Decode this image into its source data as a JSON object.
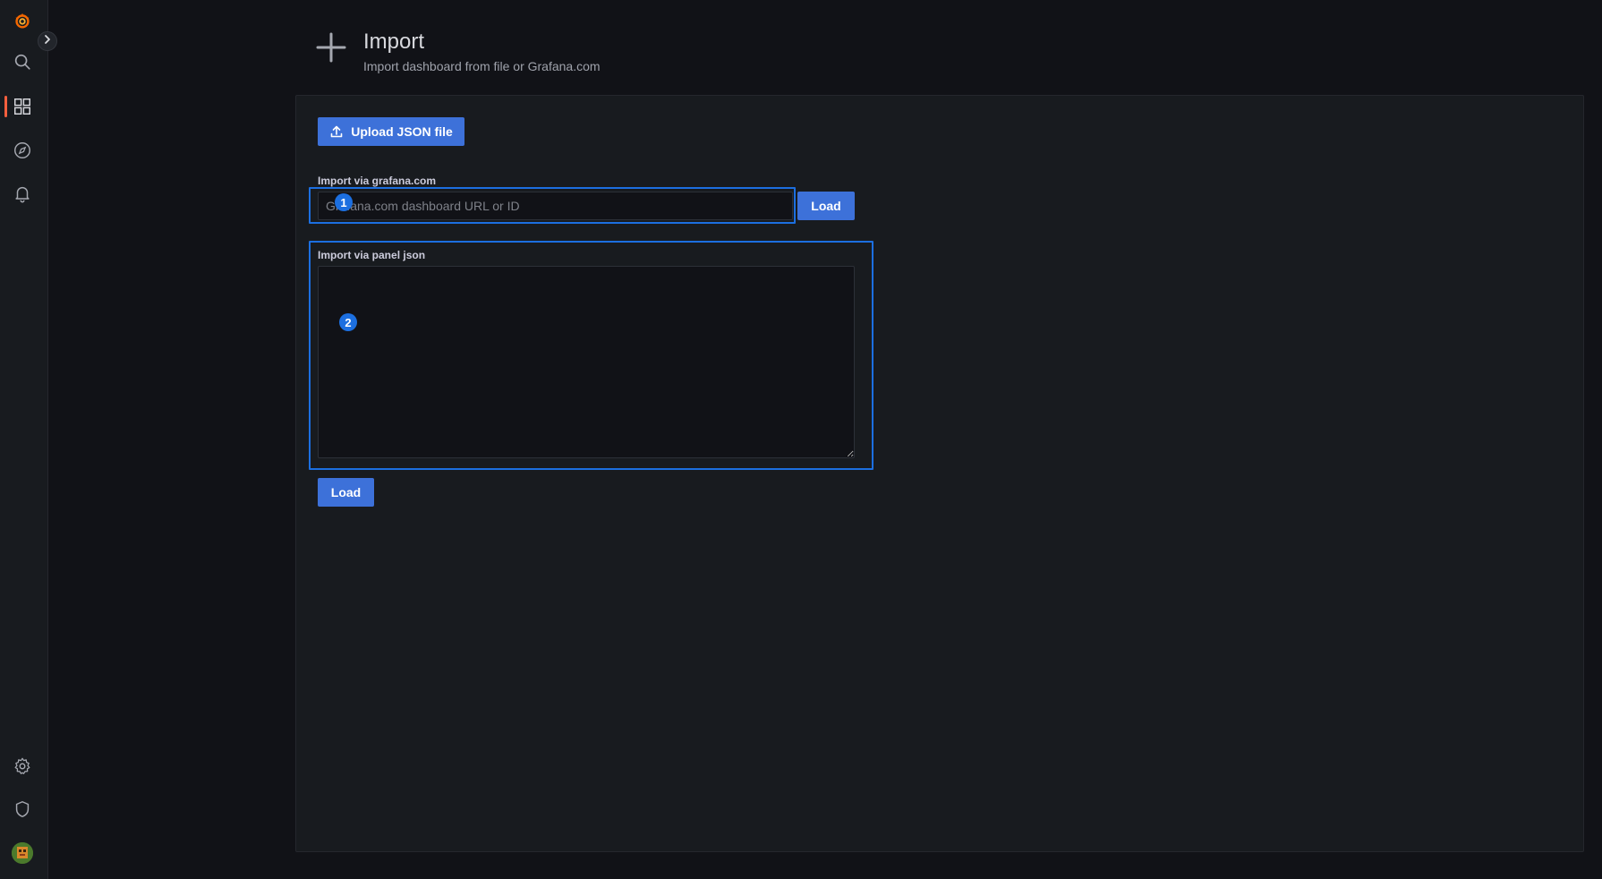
{
  "sidebar": {
    "items": [
      {
        "name": "grafana-logo-icon"
      },
      {
        "name": "search-icon"
      },
      {
        "name": "dashboards-icon",
        "active": true
      },
      {
        "name": "explore-compass-icon"
      },
      {
        "name": "alerting-bell-icon"
      },
      {
        "name": "configuration-gear-icon"
      },
      {
        "name": "server-admin-shield-icon"
      },
      {
        "name": "user-avatar"
      }
    ],
    "expand_icon": "chevron-right-icon",
    "active_color": "#f55f3e"
  },
  "header": {
    "icon": "plus-icon",
    "title": "Import",
    "subtitle": "Import dashboard from file or Grafana.com"
  },
  "upload": {
    "label": "Upload JSON file",
    "icon": "upload-icon"
  },
  "grafana_import": {
    "label": "Import via grafana.com",
    "placeholder": "Grafana.com dashboard URL or ID",
    "value": "",
    "load_label": "Load"
  },
  "panel_json": {
    "label": "Import via panel json",
    "value": "",
    "load_label": "Load"
  },
  "annotations": {
    "marker_1": "1",
    "marker_2": "2",
    "color": "#1c6fe0"
  },
  "colors": {
    "primary_button": "#3d71d9",
    "background": "#111217",
    "panel": "#181b1f"
  }
}
